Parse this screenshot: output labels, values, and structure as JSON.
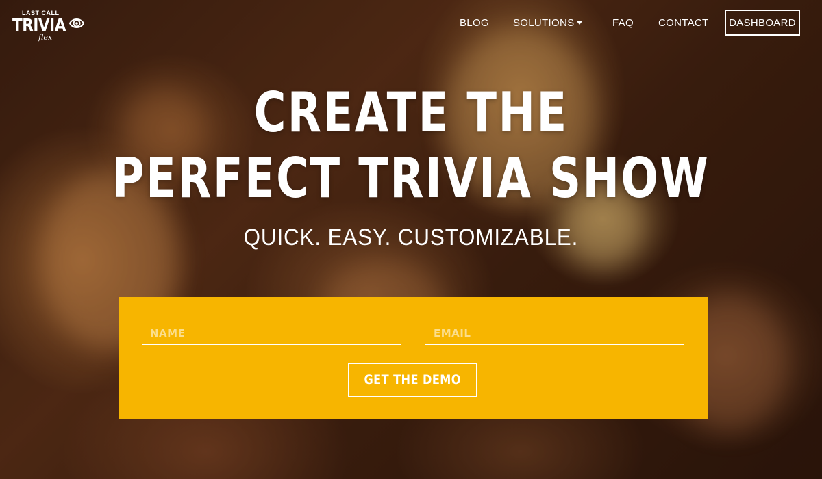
{
  "colors": {
    "accent": "#f7b500",
    "text": "#ffffff"
  },
  "logo": {
    "top_text": "LAST CALL",
    "main_text": "TRIVIA",
    "sub_text": "flex",
    "icon": "eye-icon"
  },
  "nav": {
    "blog": "BLOG",
    "solutions": "SOLUTIONS",
    "solutions_icon": "caret-down-icon",
    "faq": "FAQ",
    "contact": "CONTACT",
    "dashboard": "DASHBOARD"
  },
  "hero": {
    "title_line1": "CREATE THE",
    "title_line2": "PERFECT TRIVIA SHOW",
    "subtitle": "QUICK. EASY. CUSTOMIZABLE."
  },
  "form": {
    "name_placeholder": "NAME",
    "name_value": "",
    "email_placeholder": "EMAIL",
    "email_value": "",
    "submit_label": "GET THE DEMO"
  }
}
